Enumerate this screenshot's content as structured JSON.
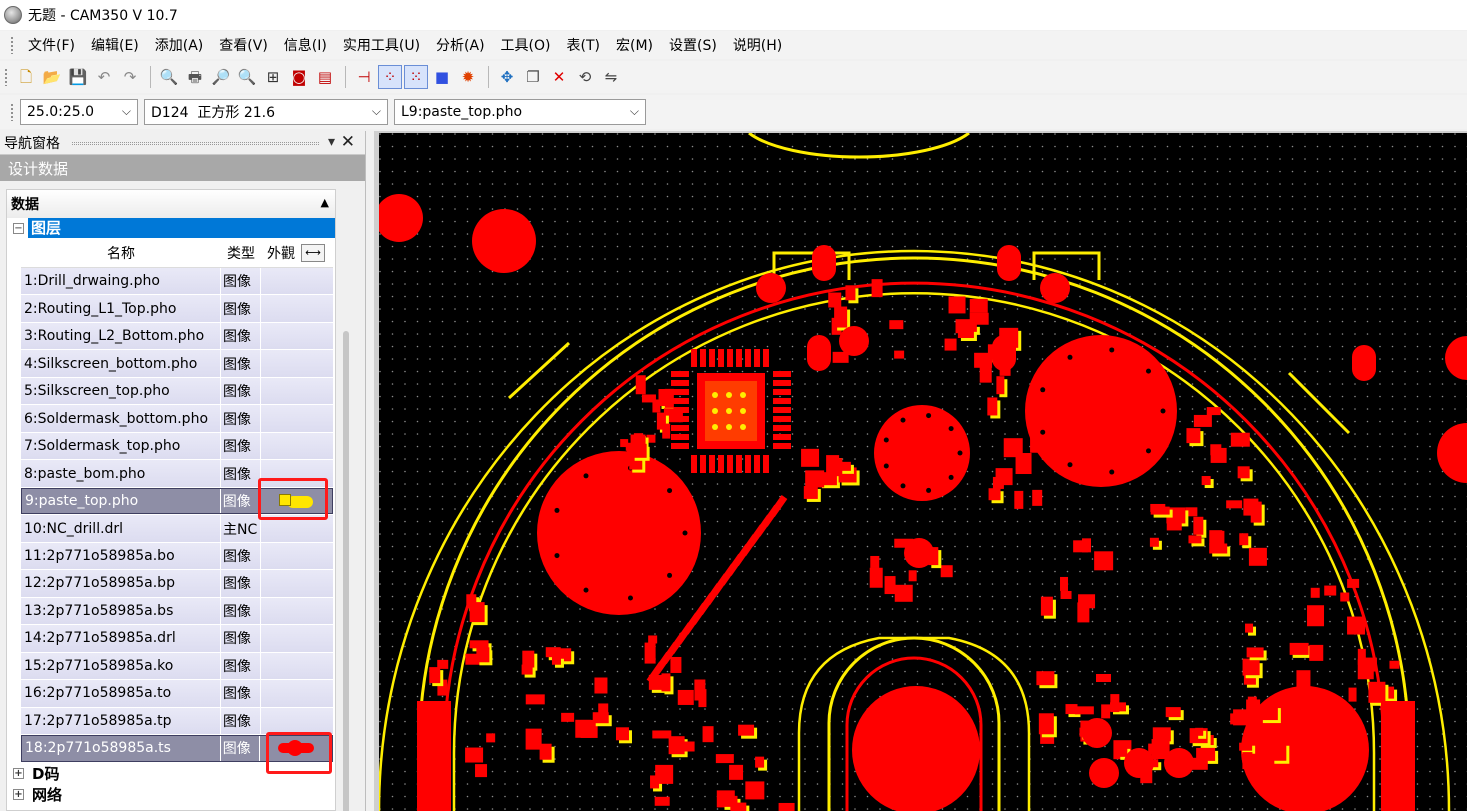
{
  "window": {
    "title": "无题 - CAM350 V 10.7"
  },
  "menu": [
    "文件(F)",
    "编辑(E)",
    "添加(A)",
    "查看(V)",
    "信息(I)",
    "实用工具(U)",
    "分析(A)",
    "工具(O)",
    "表(T)",
    "宏(M)",
    "设置(S)",
    "说明(H)"
  ],
  "toolbar": {
    "buttons": [
      {
        "name": "new-icon",
        "glyph": "🗋"
      },
      {
        "name": "open-icon",
        "glyph": "📂"
      },
      {
        "name": "save-icon",
        "glyph": "💾"
      },
      {
        "name": "undo-icon",
        "glyph": "↶"
      },
      {
        "name": "redo-icon",
        "glyph": "↷"
      },
      {
        "name": "zoom-window-icon",
        "glyph": "🔍"
      },
      {
        "name": "print-icon",
        "glyph": "🖶"
      },
      {
        "name": "zoom-in-icon",
        "glyph": "🔎"
      },
      {
        "name": "zoom-out-icon",
        "glyph": "🔍"
      },
      {
        "name": "zoom-fit-icon",
        "glyph": "⊞"
      },
      {
        "name": "redraw-icon",
        "glyph": "◙"
      },
      {
        "name": "layers-icon",
        "glyph": "▤"
      },
      {
        "name": "snap-icon",
        "glyph": "⊣"
      },
      {
        "name": "grid-icon",
        "glyph": "⁘",
        "active": true
      },
      {
        "name": "grid-dots-icon",
        "glyph": "⁙",
        "active": true
      },
      {
        "name": "color-icon",
        "glyph": "■"
      },
      {
        "name": "highlight-icon",
        "glyph": "✹"
      },
      {
        "name": "move-icon",
        "glyph": "✥"
      },
      {
        "name": "copy-icon",
        "glyph": "❐"
      },
      {
        "name": "delete-icon",
        "glyph": "✕"
      },
      {
        "name": "rotate-icon",
        "glyph": "⟲"
      },
      {
        "name": "mirror-icon",
        "glyph": "⇋"
      }
    ]
  },
  "combos": {
    "grid": "25.0:25.0",
    "dcode": "D124  正方形 21.6",
    "layer": "L9:paste_top.pho"
  },
  "nav": {
    "title": "导航窗格",
    "section": "设计数据",
    "tree_title": "数据",
    "layers_node": "图层",
    "columns": {
      "name": "名称",
      "type": "类型",
      "look": "外觀"
    },
    "layers": [
      {
        "name": "1:Drill_drwaing.pho",
        "type": "图像"
      },
      {
        "name": "2:Routing_L1_Top.pho",
        "type": "图像"
      },
      {
        "name": "3:Routing_L2_Bottom.pho",
        "type": "图像"
      },
      {
        "name": "4:Silkscreen_bottom.pho",
        "type": "图像"
      },
      {
        "name": "5:Silkscreen_top.pho",
        "type": "图像"
      },
      {
        "name": "6:Soldermask_bottom.pho",
        "type": "图像"
      },
      {
        "name": "7:Soldermask_top.pho",
        "type": "图像"
      },
      {
        "name": "8:paste_bom.pho",
        "type": "图像"
      },
      {
        "name": "9:paste_top.pho",
        "type": "图像",
        "selected": true,
        "look": "paste"
      },
      {
        "name": "10:NC_drill.drl",
        "type": "主NC"
      },
      {
        "name": "11:2p771o58985a.bo",
        "type": "图像"
      },
      {
        "name": "12:2p771o58985a.bp",
        "type": "图像"
      },
      {
        "name": "13:2p771o58985a.bs",
        "type": "图像"
      },
      {
        "name": "14:2p771o58985a.drl",
        "type": "图像"
      },
      {
        "name": "15:2p771o58985a.ko",
        "type": "图像"
      },
      {
        "name": "16:2p771o58985a.to",
        "type": "图像"
      },
      {
        "name": "17:2p771o58985a.tp",
        "type": "图像"
      },
      {
        "name": "18:2p771o58985a.ts",
        "type": "图像",
        "selected": true,
        "look": "ts"
      }
    ],
    "other_nodes": [
      "D码",
      "网络"
    ]
  },
  "colors": {
    "pad": "#ff0000",
    "silk": "#ffee00",
    "background": "#000000",
    "selection": "#0078d7",
    "highlight": "#ff1a1a"
  }
}
